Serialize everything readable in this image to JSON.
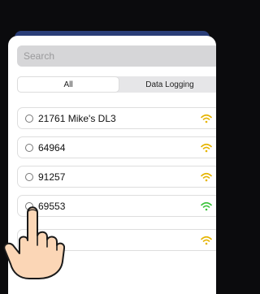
{
  "search": {
    "placeholder": "Search"
  },
  "tabs": [
    {
      "label": "All",
      "active": true
    },
    {
      "label": "Data Logging",
      "active": false
    }
  ],
  "devices": [
    {
      "name": "21761 Mike's DL3",
      "signal_color": "#e6b400"
    },
    {
      "name": "64964",
      "signal_color": "#e6b400"
    },
    {
      "name": "91257",
      "signal_color": "#e6b400"
    },
    {
      "name": "69553",
      "signal_color": "#3cc43c"
    },
    {
      "name": "",
      "signal_color": "#e6b400"
    }
  ]
}
